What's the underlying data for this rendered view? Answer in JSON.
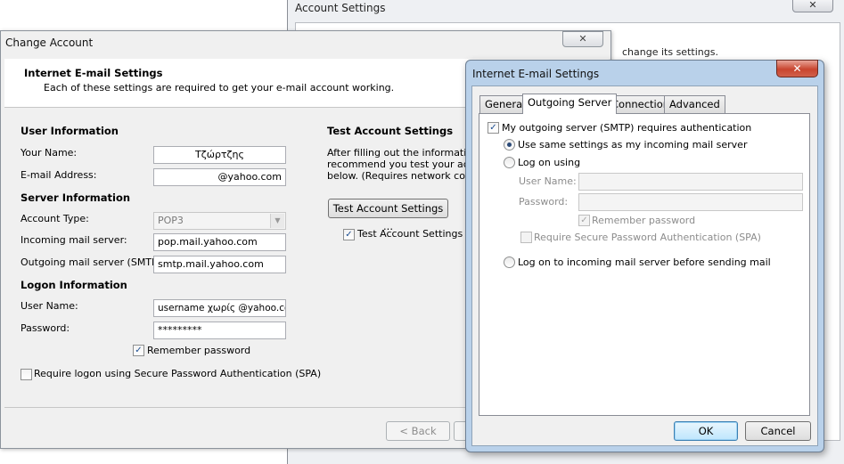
{
  "account_settings": {
    "title": "Account Settings",
    "close_glyph": "✕",
    "partial_text": "change its settings."
  },
  "change_account": {
    "title": "Change Account",
    "close_glyph": "✕",
    "header_title": "Internet E-mail Settings",
    "header_sub": "Each of these settings are required to get your e-mail account working.",
    "user_info_heading": "User Information",
    "your_name_label": "Your Name:",
    "your_name_value": "Τζώρτζης",
    "email_label": "E-mail Address:",
    "email_value": "@yahoo.com",
    "server_info_heading": "Server Information",
    "account_type_label": "Account Type:",
    "account_type_value": "POP3",
    "incoming_label": "Incoming mail server:",
    "incoming_value": "pop.mail.yahoo.com",
    "outgoing_label": "Outgoing mail server (SMTP):",
    "outgoing_value": "smtp.mail.yahoo.com",
    "logon_heading": "Logon Information",
    "username_label": "User Name:",
    "username_value": "username χωρίς @yahoo.com",
    "password_label": "Password:",
    "password_value": "*********",
    "remember_password_label": "Remember password",
    "spa_label": "Require logon using Secure Password Authentication (SPA)",
    "test_heading": "Test Account Settings",
    "test_line1": "After filling out the information o",
    "test_line2": "recommend you test your accoun",
    "test_line3": "below. (Requires network conne",
    "test_button": "Test Account Settings ...",
    "test_by_label": "Test Account Settings by",
    "back_button": "< Back"
  },
  "internet_email": {
    "title": "Internet E-mail Settings",
    "close_glyph": "✕",
    "tabs": [
      "General",
      "Outgoing Server",
      "Connection",
      "Advanced"
    ],
    "smtp_auth_label": "My outgoing server (SMTP) requires authentication",
    "same_settings_label": "Use same settings as my incoming mail server",
    "log_on_using_label": "Log on using",
    "user_name_label": "User Name:",
    "password_label": "Password:",
    "remember_password_label": "Remember password",
    "spa_label": "Require Secure Password Authentication (SPA)",
    "log_on_incoming_label": "Log on to incoming mail server before sending mail",
    "ok_button": "OK",
    "cancel_button": "Cancel"
  },
  "check_glyph": "✓"
}
